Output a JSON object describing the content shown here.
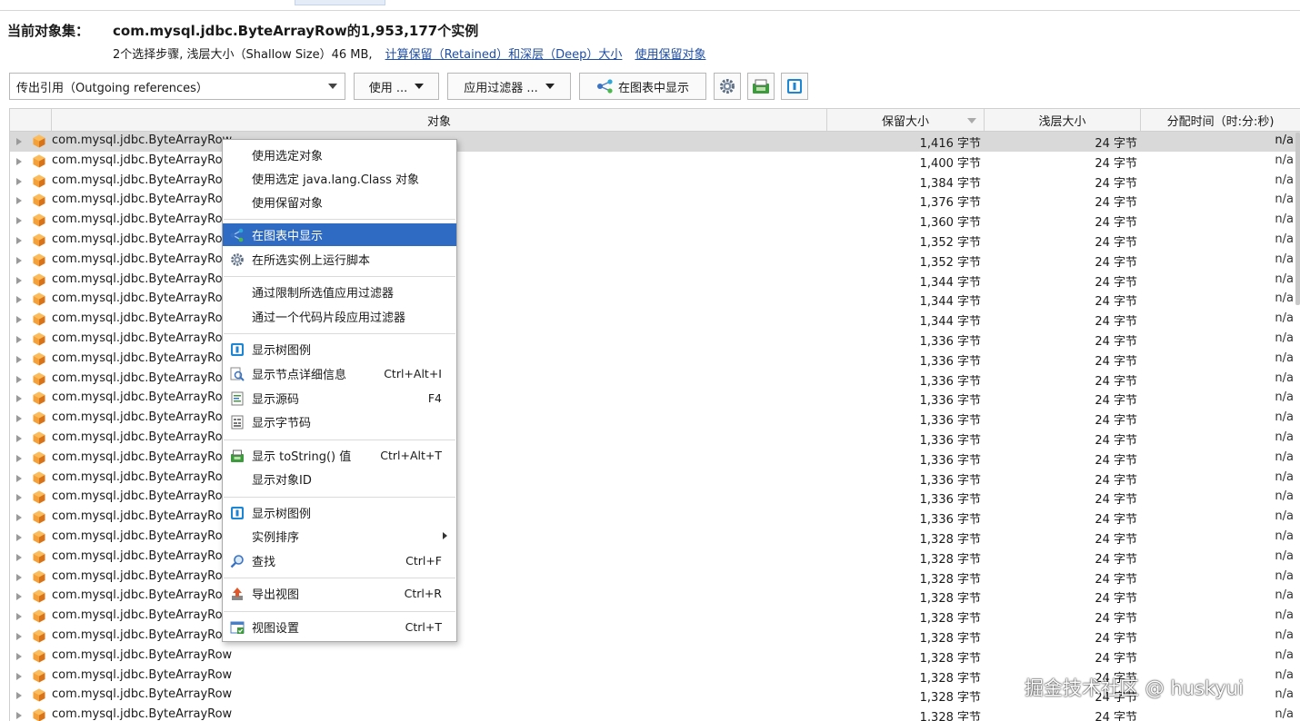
{
  "header": {
    "label": "当前对象集：",
    "title": "com.mysql.jdbc.ByteArrayRow的1,953,177个实例",
    "sub_text": "2个选择步骤, 浅层大小（Shallow Size）46 MB,",
    "link_retained": "计算保留（Retained）和深层（Deep）大小",
    "link_use_retained": "使用保留对象"
  },
  "toolbar": {
    "combo_value": "传出引用（Outgoing references）",
    "use_label": "使用 ...",
    "filter_label": "应用过滤器 ...",
    "chart_label": "在图表中显示",
    "icons": [
      "gear-icon",
      "tostring-icon",
      "tree-legend-icon"
    ]
  },
  "columns": {
    "object": "对象",
    "retained": "保留大小",
    "shallow": "浅层大小",
    "alloc": "分配时间（时:分:秒)"
  },
  "rows": [
    {
      "name": "com.mysql.jdbc.ByteArrayRow",
      "retained": "1,416 字节",
      "shallow": "24 字节",
      "alloc": "n/a"
    },
    {
      "name": "com.mysql.jdbc.ByteArrayRow",
      "retained": "1,400 字节",
      "shallow": "24 字节",
      "alloc": "n/a"
    },
    {
      "name": "com.mysql.jdbc.ByteArrayRow",
      "retained": "1,384 字节",
      "shallow": "24 字节",
      "alloc": "n/a"
    },
    {
      "name": "com.mysql.jdbc.ByteArrayRow",
      "retained": "1,376 字节",
      "shallow": "24 字节",
      "alloc": "n/a"
    },
    {
      "name": "com.mysql.jdbc.ByteArrayRow",
      "retained": "1,360 字节",
      "shallow": "24 字节",
      "alloc": "n/a"
    },
    {
      "name": "com.mysql.jdbc.ByteArrayRow",
      "retained": "1,352 字节",
      "shallow": "24 字节",
      "alloc": "n/a"
    },
    {
      "name": "com.mysql.jdbc.ByteArrayRow",
      "retained": "1,352 字节",
      "shallow": "24 字节",
      "alloc": "n/a"
    },
    {
      "name": "com.mysql.jdbc.ByteArrayRow",
      "retained": "1,344 字节",
      "shallow": "24 字节",
      "alloc": "n/a"
    },
    {
      "name": "com.mysql.jdbc.ByteArrayRow",
      "retained": "1,344 字节",
      "shallow": "24 字节",
      "alloc": "n/a"
    },
    {
      "name": "com.mysql.jdbc.ByteArrayRow",
      "retained": "1,344 字节",
      "shallow": "24 字节",
      "alloc": "n/a"
    },
    {
      "name": "com.mysql.jdbc.ByteArrayRow",
      "retained": "1,336 字节",
      "shallow": "24 字节",
      "alloc": "n/a"
    },
    {
      "name": "com.mysql.jdbc.ByteArrayRow",
      "retained": "1,336 字节",
      "shallow": "24 字节",
      "alloc": "n/a"
    },
    {
      "name": "com.mysql.jdbc.ByteArrayRow",
      "retained": "1,336 字节",
      "shallow": "24 字节",
      "alloc": "n/a"
    },
    {
      "name": "com.mysql.jdbc.ByteArrayRow",
      "retained": "1,336 字节",
      "shallow": "24 字节",
      "alloc": "n/a"
    },
    {
      "name": "com.mysql.jdbc.ByteArrayRow",
      "retained": "1,336 字节",
      "shallow": "24 字节",
      "alloc": "n/a"
    },
    {
      "name": "com.mysql.jdbc.ByteArrayRow",
      "retained": "1,336 字节",
      "shallow": "24 字节",
      "alloc": "n/a"
    },
    {
      "name": "com.mysql.jdbc.ByteArrayRow",
      "retained": "1,336 字节",
      "shallow": "24 字节",
      "alloc": "n/a"
    },
    {
      "name": "com.mysql.jdbc.ByteArrayRow",
      "retained": "1,336 字节",
      "shallow": "24 字节",
      "alloc": "n/a"
    },
    {
      "name": "com.mysql.jdbc.ByteArrayRow",
      "retained": "1,336 字节",
      "shallow": "24 字节",
      "alloc": "n/a"
    },
    {
      "name": "com.mysql.jdbc.ByteArrayRow",
      "retained": "1,336 字节",
      "shallow": "24 字节",
      "alloc": "n/a"
    },
    {
      "name": "com.mysql.jdbc.ByteArrayRow",
      "retained": "1,328 字节",
      "shallow": "24 字节",
      "alloc": "n/a"
    },
    {
      "name": "com.mysql.jdbc.ByteArrayRow",
      "retained": "1,328 字节",
      "shallow": "24 字节",
      "alloc": "n/a"
    },
    {
      "name": "com.mysql.jdbc.ByteArrayRow",
      "retained": "1,328 字节",
      "shallow": "24 字节",
      "alloc": "n/a"
    },
    {
      "name": "com.mysql.jdbc.ByteArrayRow",
      "retained": "1,328 字节",
      "shallow": "24 字节",
      "alloc": "n/a"
    },
    {
      "name": "com.mysql.jdbc.ByteArrayRow",
      "retained": "1,328 字节",
      "shallow": "24 字节",
      "alloc": "n/a"
    },
    {
      "name": "com.mysql.jdbc.ByteArrayRow",
      "retained": "1,328 字节",
      "shallow": "24 字节",
      "alloc": "n/a"
    },
    {
      "name": "com.mysql.jdbc.ByteArrayRow",
      "retained": "1,328 字节",
      "shallow": "24 字节",
      "alloc": "n/a"
    },
    {
      "name": "com.mysql.jdbc.ByteArrayRow",
      "retained": "1,328 字节",
      "shallow": "24 字节",
      "alloc": "n/a"
    },
    {
      "name": "com.mysql.jdbc.ByteArrayRow",
      "retained": "1,328 字节",
      "shallow": "24 字节",
      "alloc": "n/a"
    },
    {
      "name": "com.mysql.jdbc.ByteArrayRow",
      "retained": "1,328 字节",
      "shallow": "24 字节",
      "alloc": "n/a"
    }
  ],
  "context_menu": {
    "items": [
      {
        "label": "使用选定对象",
        "shortcut": "",
        "icon": "none"
      },
      {
        "label": "使用选定 java.lang.Class 对象",
        "shortcut": "",
        "icon": "none"
      },
      {
        "label": "使用保留对象",
        "shortcut": "",
        "icon": "none"
      },
      {
        "label": "在图表中显示",
        "shortcut": "",
        "icon": "graph-icon"
      },
      {
        "label": "在所选实例上运行脚本",
        "shortcut": "",
        "icon": "gear-icon"
      },
      {
        "label": "通过限制所选值应用过滤器",
        "shortcut": "",
        "icon": "none"
      },
      {
        "label": "通过一个代码片段应用过滤器",
        "shortcut": "",
        "icon": "none"
      },
      {
        "label": "显示树图例",
        "shortcut": "",
        "icon": "tree-legend-icon"
      },
      {
        "label": "显示节点详细信息",
        "shortcut": "Ctrl+Alt+I",
        "icon": "magnifier-doc-icon"
      },
      {
        "label": "显示源码",
        "shortcut": "F4",
        "icon": "source-icon"
      },
      {
        "label": "显示字节码",
        "shortcut": "",
        "icon": "bytecode-icon"
      },
      {
        "label": "显示 toString() 值",
        "shortcut": "Ctrl+Alt+T",
        "icon": "tostring-icon"
      },
      {
        "label": "显示对象ID",
        "shortcut": "",
        "icon": "none"
      },
      {
        "label": "显示树图例",
        "shortcut": "",
        "icon": "tree-legend-icon"
      },
      {
        "label": "实例排序",
        "shortcut": "",
        "icon": "none"
      },
      {
        "label": "查找",
        "shortcut": "Ctrl+F",
        "icon": "search-icon"
      },
      {
        "label": "导出视图",
        "shortcut": "Ctrl+R",
        "icon": "export-icon"
      },
      {
        "label": "视图设置",
        "shortcut": "Ctrl+T",
        "icon": "view-settings-icon"
      }
    ]
  },
  "watermark": "掘金技术社区 @ huskyui",
  "colors": {
    "accent": "#2f6bc2",
    "link": "#1f4ea3",
    "cube": "#f08a1c",
    "selected_row": "#d9d9d9"
  }
}
